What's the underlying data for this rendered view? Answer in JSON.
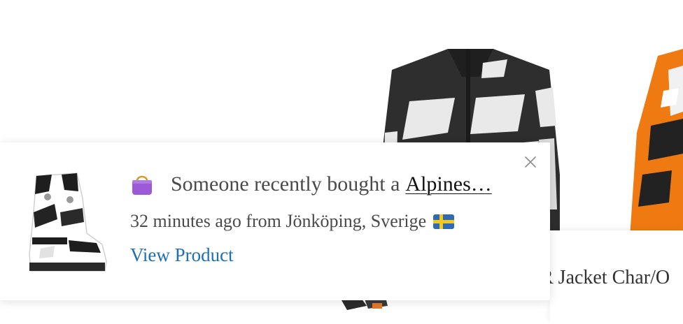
{
  "background": {
    "product_title": "R Jacket Char/O"
  },
  "notification": {
    "message_prefix": "Someone recently bought a",
    "product_name": "Alpines…",
    "time_location": "32 minutes ago from Jönköping, Sverige",
    "view_label": "View Product",
    "icons": {
      "bag": "shopping-bag-icon",
      "flag": "sweden-flag-icon",
      "close": "close-icon"
    }
  },
  "colors": {
    "bag": "#9b5ad6",
    "link": "#1f6fb2",
    "flag_blue": "#2f6bb5",
    "flag_yellow": "#f6c81a",
    "jacket_orange": "#f07a12"
  }
}
